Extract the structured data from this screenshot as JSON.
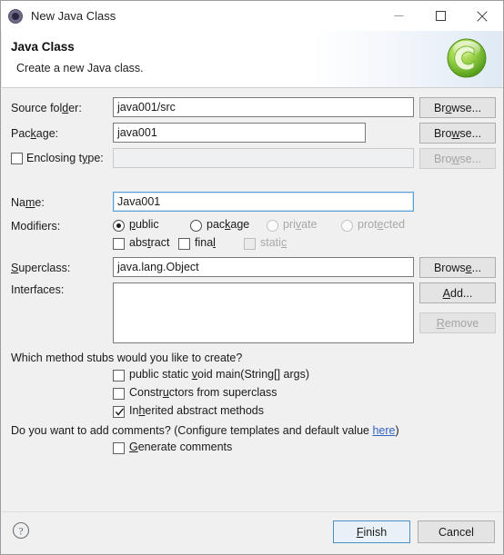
{
  "window": {
    "title": "New Java Class",
    "icon": "eclipse-wizard-icon",
    "minimize_label": "Minimize",
    "maximize_label": "Maximize",
    "close_label": "Close"
  },
  "header": {
    "title": "Java Class",
    "description": "Create a new Java class.",
    "banner_icon": "green-java-class-icon"
  },
  "form": {
    "source_folder": {
      "label": "Source folder:",
      "value": "java001/src",
      "button": "Browse..."
    },
    "package": {
      "label": "Package:",
      "value": "java001",
      "button": "Browse..."
    },
    "enclosing_type": {
      "label": "Enclosing type:",
      "value": "",
      "checked": false,
      "button": "Browse...",
      "enabled": false
    },
    "name": {
      "label": "Name:",
      "value": "Java001"
    },
    "modifiers": {
      "label": "Modifiers:",
      "access": [
        {
          "label": "public",
          "selected": true,
          "enabled": true
        },
        {
          "label": "package",
          "selected": false,
          "enabled": true
        },
        {
          "label": "private",
          "selected": false,
          "enabled": false
        },
        {
          "label": "protected",
          "selected": false,
          "enabled": false
        }
      ],
      "flags": [
        {
          "label": "abstract",
          "checked": false,
          "enabled": true
        },
        {
          "label": "final",
          "checked": false,
          "enabled": true
        },
        {
          "label": "static",
          "checked": false,
          "enabled": false
        }
      ]
    },
    "superclass": {
      "label": "Superclass:",
      "value": "java.lang.Object",
      "button": "Browse..."
    },
    "interfaces": {
      "label": "Interfaces:",
      "items": [],
      "add_button": "Add...",
      "remove_button": "Remove",
      "remove_enabled": false
    }
  },
  "stubs": {
    "question": "Which method stubs would you like to create?",
    "options": [
      {
        "label": "public static void main(String[] args)",
        "checked": false
      },
      {
        "label": "Constructors from superclass",
        "checked": false
      },
      {
        "label": "Inherited abstract methods",
        "checked": true
      }
    ]
  },
  "comments": {
    "question_prefix": "Do you want to add comments? (Configure templates and default value ",
    "link": "here",
    "question_suffix": ")",
    "option": {
      "label": "Generate comments",
      "checked": false
    }
  },
  "footer": {
    "help_icon": "help-question-icon",
    "finish_label": "Finish",
    "cancel_label": "Cancel"
  },
  "colors": {
    "accent": "#4a90c4",
    "link": "#2f62bf",
    "dialog_bg": "#f0f0f0",
    "logo_green": "#7dc242"
  }
}
